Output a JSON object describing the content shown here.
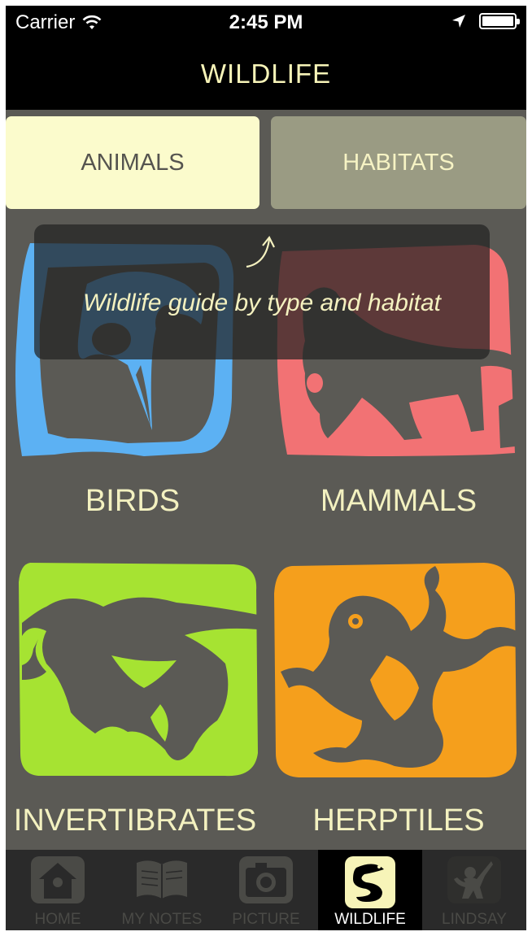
{
  "status": {
    "carrier": "Carrier",
    "time": "2:45 PM"
  },
  "nav": {
    "title": "WILDLIFE"
  },
  "segments": {
    "animals": "ANIMALS",
    "habitats": "HABITATS",
    "selected": "animals"
  },
  "tooltip": {
    "text": "Wildlife guide by type and habitat"
  },
  "tiles": [
    {
      "label": "BIRDS",
      "color": "#5cb1f3",
      "icon": "bird-icon"
    },
    {
      "label": "MAMMALS",
      "color": "#f27274",
      "icon": "mammal-icon"
    },
    {
      "label": "INVERTIBRATES",
      "color": "#a6e332",
      "icon": "insect-icon"
    },
    {
      "label": "HERPTILES",
      "color": "#f59f1c",
      "icon": "frog-icon"
    }
  ],
  "tabs": [
    {
      "label": "HOME",
      "icon": "birdhouse-icon"
    },
    {
      "label": "MY NOTES",
      "icon": "notebook-icon"
    },
    {
      "label": "PICTURE",
      "icon": "camera-icon"
    },
    {
      "label": "WILDLIFE",
      "icon": "snake-icon",
      "active": true
    },
    {
      "label": "LINDSAY",
      "icon": "child-icon"
    }
  ],
  "colors": {
    "background": "#5b5a55",
    "accent_text": "#f7f4b8",
    "segment_selected": "#fbfbcc",
    "segment_unselected": "#9a9b83"
  }
}
